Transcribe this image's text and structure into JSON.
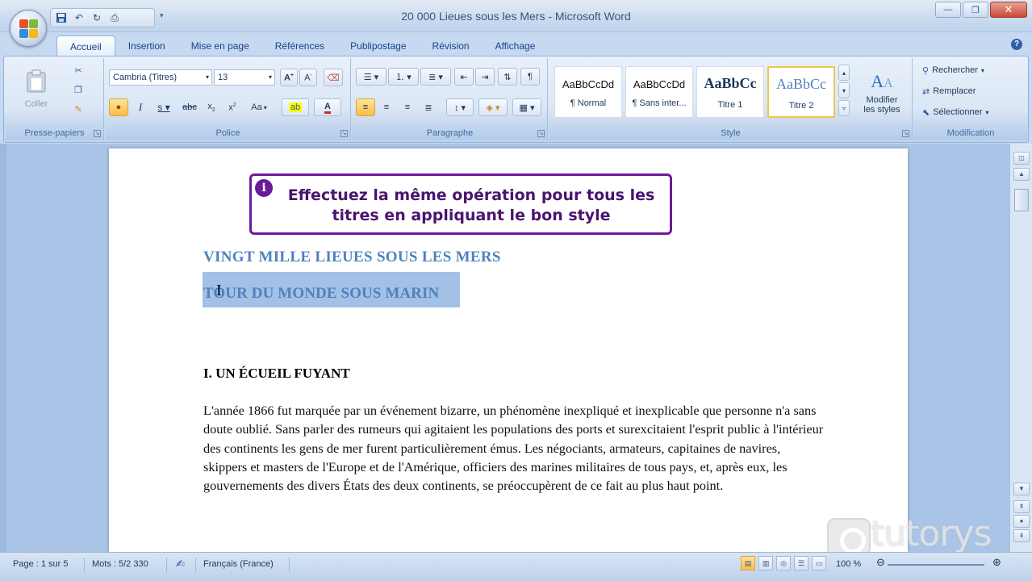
{
  "window": {
    "title": "20 000 Lieues sous les Mers - Microsoft Word",
    "controls": [
      "minimize",
      "maximize",
      "close"
    ]
  },
  "quick_access": {
    "icons": [
      "save-icon",
      "undo-icon",
      "redo-icon",
      "print-icon"
    ]
  },
  "tabs": [
    {
      "label": "Accueil",
      "active": true
    },
    {
      "label": "Insertion"
    },
    {
      "label": "Mise en page"
    },
    {
      "label": "Références"
    },
    {
      "label": "Publipostage"
    },
    {
      "label": "Révision"
    },
    {
      "label": "Affichage"
    }
  ],
  "ribbon": {
    "clipboard": {
      "paste_label": "Coller",
      "group_label": "Presse-papiers"
    },
    "font": {
      "font_name": "Cambria (Titres)",
      "font_size": "13",
      "group_label": "Police",
      "change_case": "Aa"
    },
    "paragraph": {
      "group_label": "Paragraphe"
    },
    "styles": {
      "group_label": "Style",
      "tiles": [
        {
          "sample": "AaBbCcDd",
          "name": "¶ Normal"
        },
        {
          "sample": "AaBbCcDd",
          "name": "¶ Sans inter..."
        },
        {
          "sample": "AaBbCc",
          "name": "Titre 1"
        },
        {
          "sample": "AaBbCc",
          "name": "Titre 2",
          "selected": true
        }
      ],
      "modify_label_1": "Modifier",
      "modify_label_2": "les styles"
    },
    "editing": {
      "group_label": "Modification",
      "find": "Rechercher",
      "replace": "Remplacer",
      "select": "Sélectionner"
    }
  },
  "document": {
    "callout": "Effectuez la même opération pour tous les titres en appliquant le bon style",
    "heading1": "VINGT MILLE LIEUES SOUS LES MERS",
    "heading2": "TOUR DU MONDE SOUS MARIN",
    "chapter": "I. UN ÉCUEIL FUYANT",
    "paragraph": "L'année 1866 fut marquée par un événement bizarre, un phénomène inexpliqué et inexplicable que personne n'a sans doute oublié. Sans parler des rumeurs qui agitaient les populations des ports et surexcitaient l'esprit public à l'intérieur des continents les gens de mer furent particulièrement émus. Les négociants, armateurs, capitaines de navires, skippers et masters de l'Europe et de l'Amérique, officiers des marines militaires de tous pays, et, après eux, les gouvernements des divers États des deux continents, se préoccupèrent de ce fait au plus haut point."
  },
  "statusbar": {
    "page": "Page : 1 sur 5",
    "words": "Mots : 5/2 330",
    "language": "Français (France)",
    "zoom": "100 %"
  },
  "watermark": {
    "text": "tutorys"
  },
  "colors": {
    "accent": "#4f81bd",
    "callout_border": "#6a1b9a",
    "selection": "#a3c0e6"
  }
}
